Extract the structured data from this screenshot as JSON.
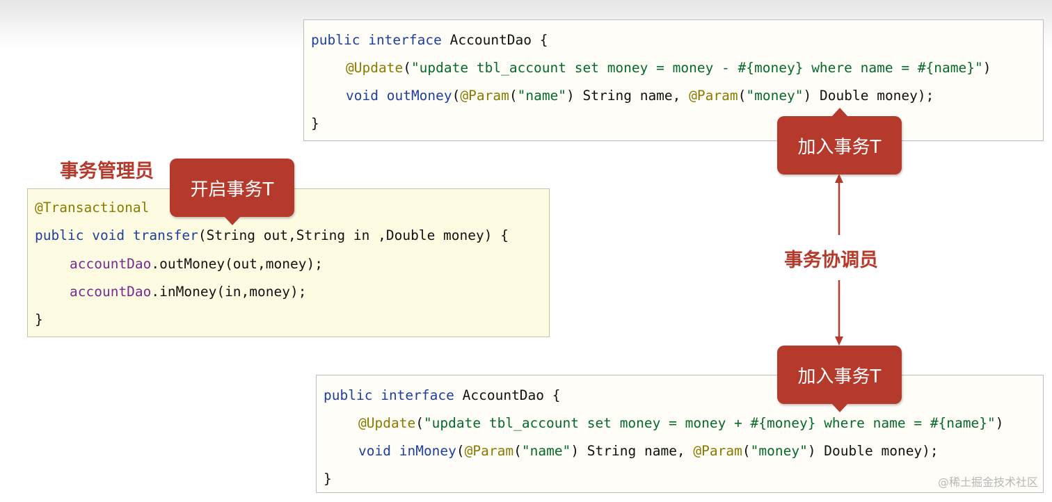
{
  "top_code": {
    "line1": {
      "kw1": "public",
      "kw2": "interface",
      "rest": "AccountDao {"
    },
    "line2": {
      "ann": "@Update",
      "p1": "(",
      "str": "\"update tbl_account set money = money - #{money} where name = #{name}\"",
      "p2": ")"
    },
    "line3": {
      "kw": "void",
      "method": "outMoney",
      "p1": "(",
      "ann1": "@Param",
      "p2": "(",
      "str1": "\"name\"",
      "p3": ") String name, ",
      "ann2": "@Param",
      "p4": "(",
      "str2": "\"money\"",
      "p5": ") Double money);"
    },
    "line4": "}"
  },
  "manager_code": {
    "line1": "@Transactional",
    "line2": {
      "kw1": "public",
      "kw2": "void",
      "method": "transfer",
      "rest": "(String out,String in ,Double money) {"
    },
    "line3": {
      "field": "accountDao",
      "rest": ".outMoney(out,money);"
    },
    "line4": {
      "field": "accountDao",
      "rest": ".inMoney(in,money);"
    },
    "line5": "}"
  },
  "bottom_code": {
    "line1": {
      "kw1": "public",
      "kw2": "interface",
      "rest": "AccountDao {"
    },
    "line2": {
      "ann": "@Update",
      "p1": "(",
      "str": "\"update tbl_account set money = money + #{money} where name = #{name}\"",
      "p2": ")"
    },
    "line3": {
      "kw": "void",
      "method": "inMoney",
      "p1": "(",
      "ann1": "@Param",
      "p2": "(",
      "str1": "\"name\"",
      "p3": ") String name, ",
      "ann2": "@Param",
      "p4": "(",
      "str2": "\"money\"",
      "p5": ") Double money);"
    },
    "line4": "}"
  },
  "labels": {
    "manager": "事务管理员",
    "coordinator": "事务协调员",
    "start_tx": "开启事务T",
    "join_tx_top": "加入事务T",
    "join_tx_bottom": "加入事务T",
    "watermark": "@稀土掘金技术社区"
  },
  "colors": {
    "accent": "#b53a2b",
    "keyword": "#1f3f9a",
    "annotation": "#8a7a00",
    "string": "#076a2a",
    "field": "#7a2a8f"
  }
}
